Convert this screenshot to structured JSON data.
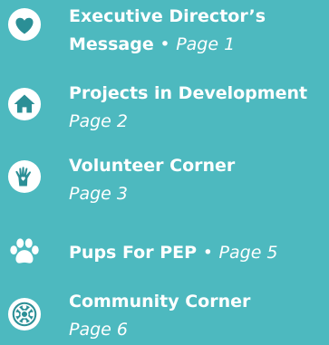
{
  "items": [
    {
      "title_line1": "Executive Director’s",
      "title_line2": "Message",
      "separator": "•",
      "page": "Page 1",
      "icon": "heart-icon"
    },
    {
      "title": "Projects in Development",
      "page": "Page 2",
      "icon": "house-icon"
    },
    {
      "title": "Volunteer Corner",
      "page": "Page 3",
      "icon": "hand-heart-icon"
    },
    {
      "title": "Pups For PEP",
      "separator": "•",
      "page": "Page 5",
      "icon": "paw-icon"
    },
    {
      "title": "Community Corner",
      "page": "Page 6",
      "icon": "community-icon"
    }
  ],
  "colors": {
    "background": "#4db9bf",
    "text": "#ffffff",
    "icon_fill": "#2b8f96"
  }
}
